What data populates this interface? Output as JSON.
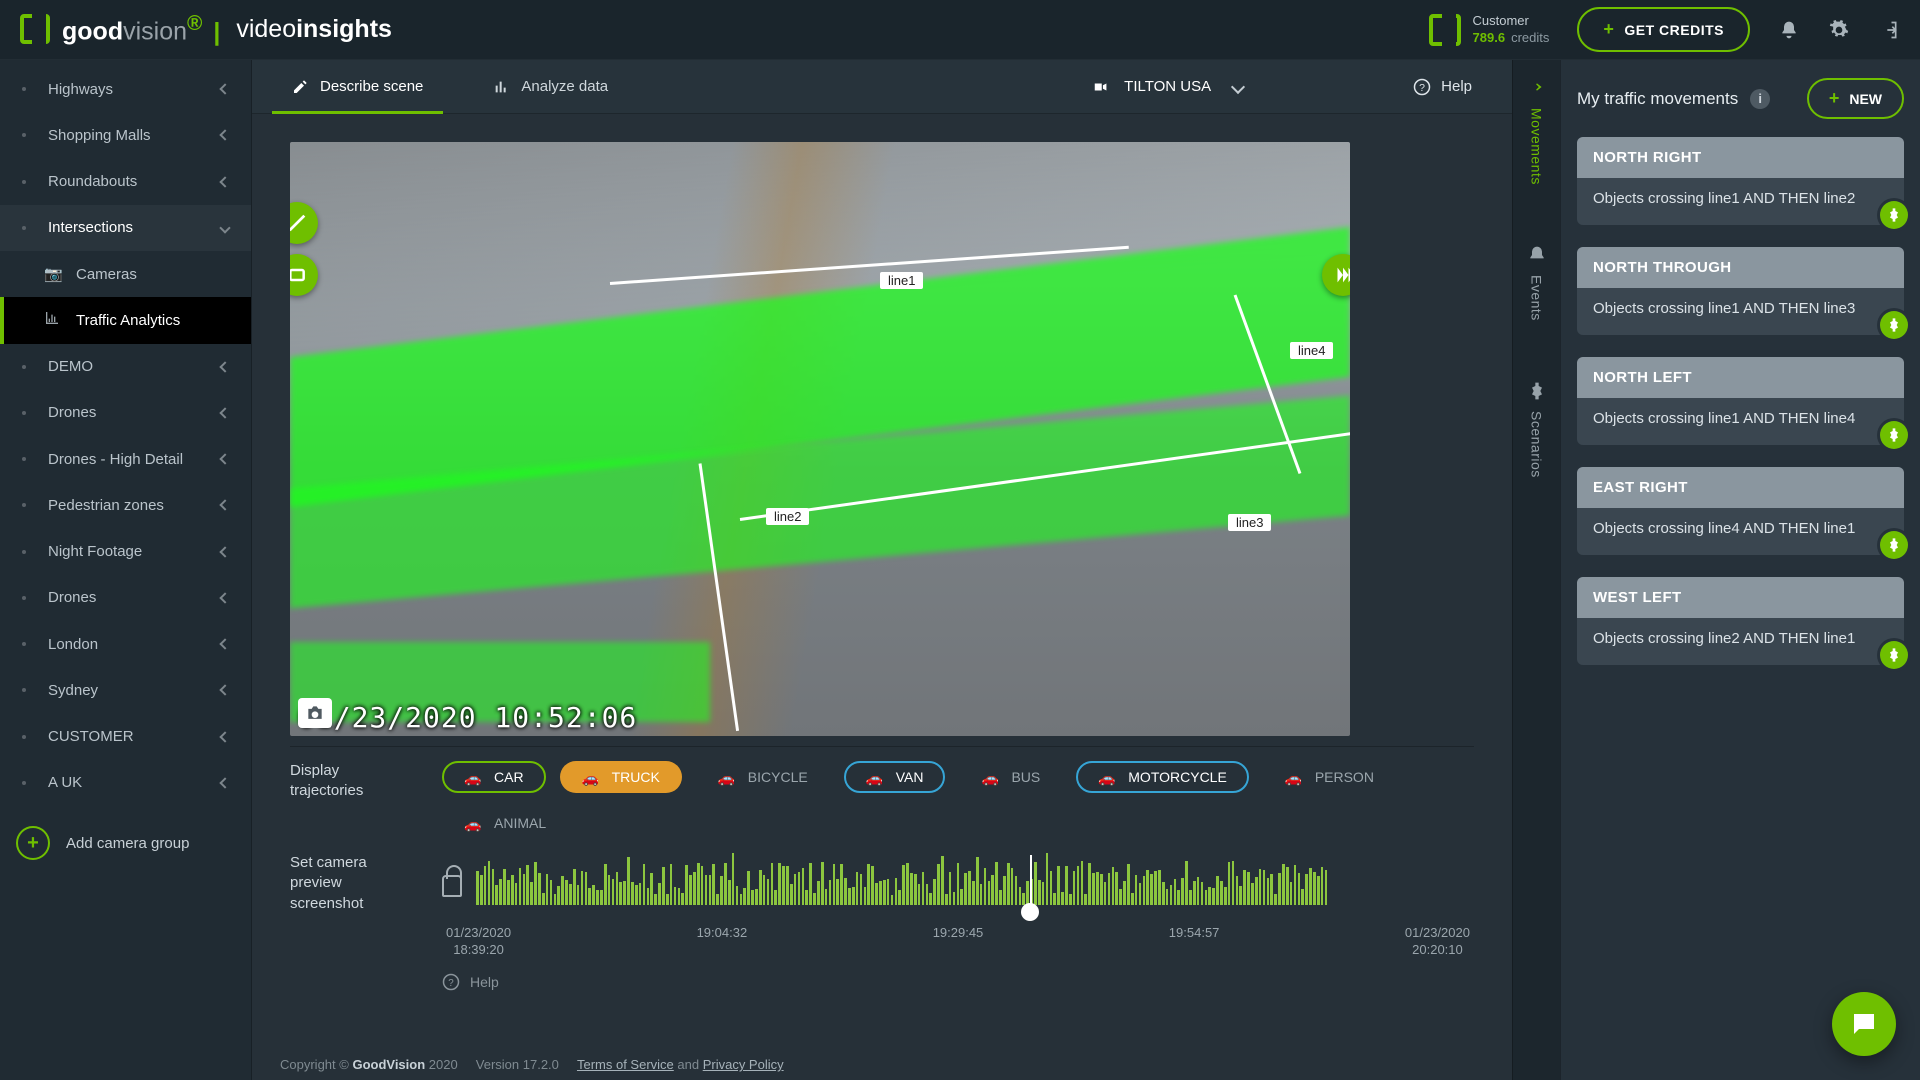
{
  "header": {
    "brand_good": "good",
    "brand_vision": "vision",
    "brand_sup": "®",
    "brand_pipe": "|",
    "brand_video": "video",
    "brand_insights": "insights",
    "customer_label": "Customer",
    "customer_credits_num": "789.6",
    "customer_credits_lbl": "credits",
    "get_credits": "GET CREDITS"
  },
  "sidebar": {
    "items": [
      {
        "label": "Highways"
      },
      {
        "label": "Shopping Malls"
      },
      {
        "label": "Roundabouts"
      },
      {
        "label": "Intersections"
      },
      {
        "label": "DEMO"
      },
      {
        "label": "Drones"
      },
      {
        "label": "Drones - High Detail"
      },
      {
        "label": "Pedestrian zones"
      },
      {
        "label": "Night Footage"
      },
      {
        "label": "Drones"
      },
      {
        "label": "London"
      },
      {
        "label": "Sydney"
      },
      {
        "label": "CUSTOMER"
      },
      {
        "label": "A UK"
      }
    ],
    "sub": {
      "cameras": "Cameras",
      "traffic": "Traffic Analytics"
    },
    "add": "Add camera group"
  },
  "tabs": {
    "describe": "Describe scene",
    "analyze": "Analyze data",
    "camera": "TILTON USA",
    "help": "Help"
  },
  "canvas": {
    "line1": "line1",
    "line2": "line2",
    "line3": "line3",
    "line4": "line4",
    "timestamp": "01/23/2020 10:52:06"
  },
  "trajectories": {
    "title": "Display trajectories",
    "chips": [
      {
        "label": "CAR",
        "state": "on-car"
      },
      {
        "label": "TRUCK",
        "state": "fill-truck"
      },
      {
        "label": "BICYCLE",
        "state": ""
      },
      {
        "label": "VAN",
        "state": "on-van"
      },
      {
        "label": "BUS",
        "state": ""
      },
      {
        "label": "MOTORCYCLE",
        "state": "on-moto"
      },
      {
        "label": "PERSON",
        "state": ""
      },
      {
        "label": "ANIMAL",
        "state": ""
      }
    ]
  },
  "timeline": {
    "title": "Set camera preview screenshot",
    "help": "Help",
    "ticks": [
      {
        "a": "01/23/2020",
        "b": "18:39:20"
      },
      {
        "a": "19:04:32",
        "b": ""
      },
      {
        "a": "19:29:45",
        "b": ""
      },
      {
        "a": "19:54:57",
        "b": ""
      },
      {
        "a": "01/23/2020",
        "b": "20:20:10"
      }
    ]
  },
  "footer": {
    "copyright": "Copyright © ",
    "brand": "GoodVision",
    "year": " 2020",
    "version": "Version 17.2.0",
    "tos": "Terms of Service",
    "and": " and ",
    "pp": "Privacy Policy"
  },
  "rail": {
    "movements": "Movements",
    "events": "Events",
    "scenarios": "Scenarios"
  },
  "right": {
    "title": "My traffic movements",
    "new": "NEW",
    "cards": [
      {
        "title": "NORTH RIGHT",
        "desc": "Objects crossing line1 AND THEN line2"
      },
      {
        "title": "NORTH THROUGH",
        "desc": "Objects crossing line1 AND THEN line3"
      },
      {
        "title": "NORTH LEFT",
        "desc": "Objects crossing line1 AND THEN line4"
      },
      {
        "title": "EAST RIGHT",
        "desc": "Objects crossing line4 AND THEN line1"
      },
      {
        "title": "WEST LEFT",
        "desc": "Objects crossing line2 AND THEN line1"
      }
    ]
  }
}
